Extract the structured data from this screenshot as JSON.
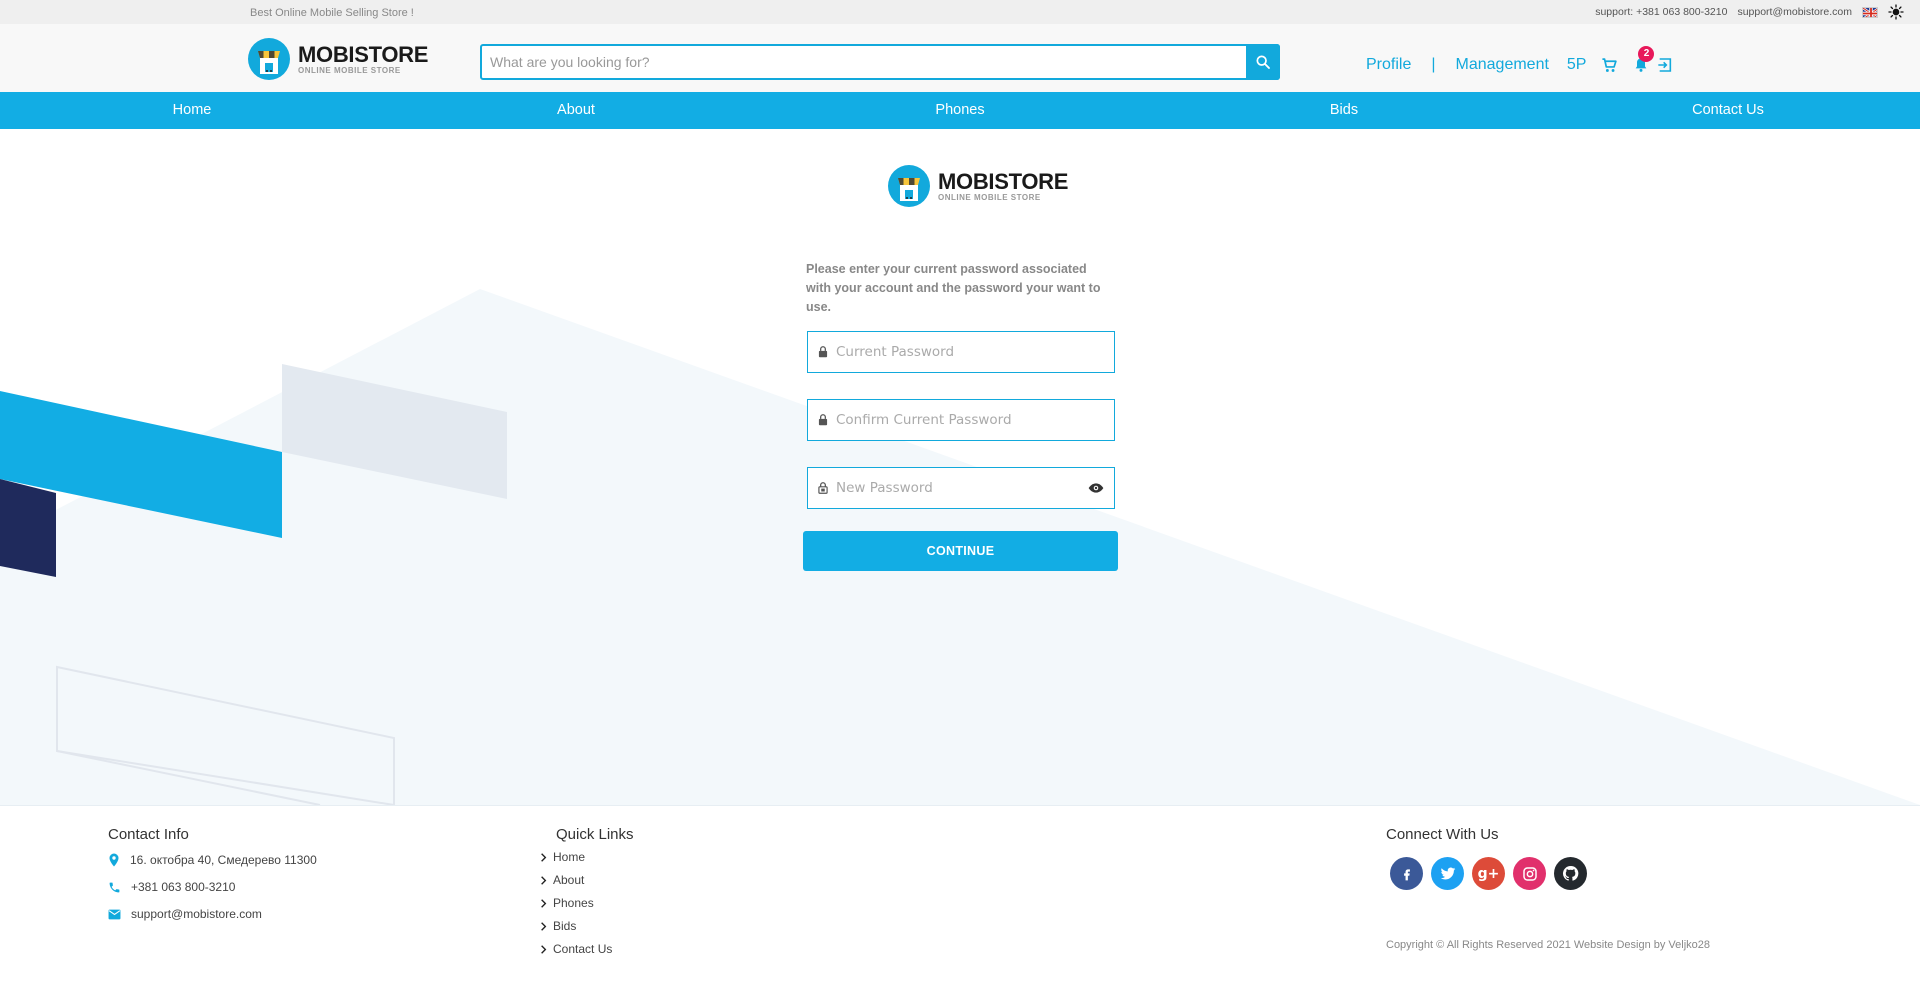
{
  "topbar": {
    "tagline": "Best Online Mobile Selling Store !",
    "support_phone": "support: +381 063 800-3210",
    "support_email": "support@mobistore.com"
  },
  "brand": {
    "name": "MOBISTORE",
    "subtitle": "ONLINE MOBILE STORE"
  },
  "search": {
    "placeholder": "What are you looking for?",
    "value": ""
  },
  "header_nav": {
    "profile": "Profile",
    "separator": "|",
    "management": "Management",
    "points": "5P",
    "notification_count": "2"
  },
  "nav": [
    "Home",
    "About",
    "Phones",
    "Bids",
    "Contact Us"
  ],
  "form": {
    "intro_line1": "Please enter your current password associated",
    "intro_line2": "with your account and the password your want to use.",
    "current_placeholder": "Current Password",
    "confirm_placeholder": "Confirm Current Password",
    "new_placeholder": "New Password",
    "submit": "CONTINUE"
  },
  "footer": {
    "contact_title": "Contact Info",
    "address": "16. октобра 40, Смедерево 11300",
    "phone": "+381 063 800-3210",
    "email": "support@mobistore.com",
    "quick_title": "Quick Links",
    "quick_links": [
      "Home",
      "About",
      "Phones",
      "Bids",
      "Contact Us"
    ],
    "connect_title": "Connect With Us",
    "copyright": "Copyright © All Rights Reserved 2021 Website Design by Veljko28"
  },
  "colors": {
    "accent": "#12ade4",
    "badge": "#e8185a",
    "navy": "#1f2a5c",
    "facebook": "#3b5998",
    "twitter": "#1da1f2",
    "google_plus": "#dd4b39",
    "instagram": "#e1306c",
    "github": "#24292e"
  },
  "icons": [
    "search-icon",
    "cart-icon",
    "bell-icon",
    "logout-icon",
    "lock-icon",
    "eye-icon",
    "location-icon",
    "phone-icon",
    "mail-icon",
    "chevron-right-icon",
    "sun-icon",
    "uk-flag-icon"
  ]
}
